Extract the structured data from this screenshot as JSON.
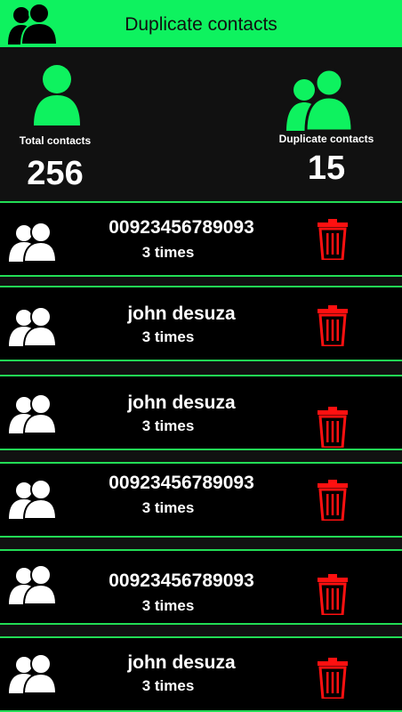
{
  "header": {
    "title": "Duplicate contacts",
    "icon": "people-icon"
  },
  "summary": {
    "total_label": "Total contacts",
    "total_value": "256",
    "duplicate_label": "Duplicate contacts",
    "duplicate_value": "15"
  },
  "rows": [
    {
      "name": "00923456789093",
      "count": "3 times"
    },
    {
      "name": "john desuza",
      "count": "3 times"
    },
    {
      "name": "john desuza",
      "count": "3 times"
    },
    {
      "name": "00923456789093",
      "count": "3 times"
    },
    {
      "name": "00923456789093",
      "count": "3 times"
    },
    {
      "name": "john desuza",
      "count": "3 times"
    }
  ],
  "colors": {
    "accent": "#0ef25f",
    "separator": "#22dd55",
    "delete": "#ff1010",
    "background": "#000000",
    "panel": "#111111"
  },
  "icons": {
    "avatar": "people-icon",
    "delete": "trash-icon"
  }
}
